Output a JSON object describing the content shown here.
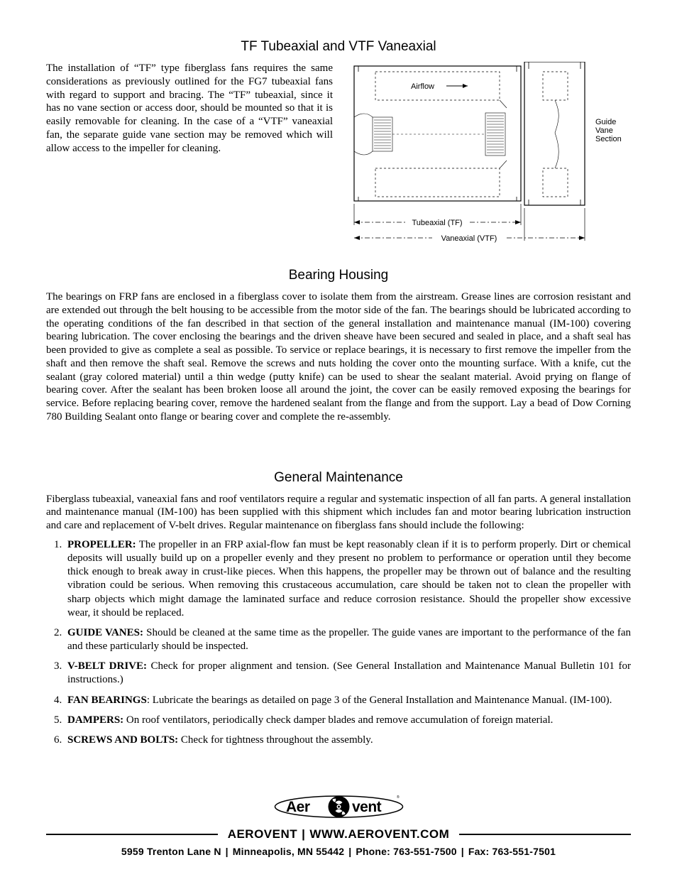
{
  "headings": {
    "h1": "TF Tubeaxial and VTF Vaneaxial",
    "h2": "Bearing Housing",
    "h3": "General Maintenance"
  },
  "top_paragraph": "The installation of “TF” type fiberglass fans requires the same considerations as previously outlined for the FG7 tubeaxial fans with regard to support and bracing. The “TF” tubeaxial, since it has no vane section or access door, should be mounted so that it is easily removable for cleaning. In the case of a “VTF” vaneaxial fan, the separate guide vane section may be removed which will allow access to the impeller for cleaning.",
  "figure": {
    "airflow": "Airflow",
    "guide_vane": "Guide\nVane\nSection",
    "tubeaxial": "Tubeaxial (TF)",
    "vaneaxial": "Vaneaxial (VTF)"
  },
  "bearing_paragraph": "The bearings on FRP fans are enclosed in a fiberglass cover to isolate them from the airstream. Grease lines are corrosion resistant and are extended out through the belt housing to be accessible from the motor side of the fan. The bearings should be lubricated according to the operating conditions of the fan described in that section of the general installation and maintenance manual (IM-100) covering bearing lubrication. The cover enclosing the bearings and the driven sheave have been secured and sealed in place, and a shaft seal has been provided to give as complete a seal as possible. To service or replace bearings, it is necessary to first remove the impeller from the shaft and then remove the shaft seal. Remove the screws and nuts holding the cover onto the mounting surface. With a knife, cut the sealant (gray colored material) until a thin wedge (putty knife) can be used to shear the sealant material. Avoid prying on flange of bearing cover. After the sealant has been broken loose all around the joint, the cover can be easily removed exposing the bearings for service. Before replacing bearing cover, remove the hardened sealant from the flange and from the support. Lay a bead of Dow Corning 780 Building Sealant onto flange or bearing cover and complete the re-assembly.",
  "general_intro": "Fiberglass tubeaxial, vaneaxial fans and roof ventilators require a regular and systematic inspection of all fan parts. A general installation and maintenance manual (IM-100) has been supplied with this shipment which includes fan and motor bearing lubrication instruction and care and replacement of V-belt drives. Regular maintenance on fiberglass fans should include the following:",
  "maintenance": [
    {
      "label": "PROPELLER:",
      "text": " The propeller in an FRP axial-flow fan must be kept reasonably clean if it is to perform properly. Dirt or chemical deposits will usually build up on a propeller evenly and they present no problem to performance or operation until they become thick enough to break away in crust-like pieces. When this happens, the propeller may be thrown out of balance and the resulting vibration could be serious. When removing this crustaceous accumulation, care should be taken not to clean the propeller with sharp objects which might damage the laminated surface and reduce corrosion resistance. Should the propeller show excessive wear, it should be replaced."
    },
    {
      "label": "GUIDE VANES:",
      "text": " Should be cleaned at the same time as the propeller. The guide vanes are important to the performance of the fan and these particularly should be inspected."
    },
    {
      "label": "V-BELT DRIVE:",
      "text": " Check for proper alignment and tension. (See General Installation and Maintenance Manual Bulletin 101 for instructions.)"
    },
    {
      "label": "FAN BEARINGS",
      "text": ": Lubricate the bearings as detailed on page 3 of the General Installation and Maintenance Manual. (IM-100)."
    },
    {
      "label": "DAMPERS:",
      "text": " On roof ventilators, periodically check damper blades and remove accumulation of foreign material."
    },
    {
      "label": "SCREWS AND BOLTS:",
      "text": " Check for tightness throughout the assembly."
    }
  ],
  "footer": {
    "brand": "AEROVENT",
    "sep": "|",
    "url": "WWW.AEROVENT.COM",
    "address": "5959 Trenton Lane N",
    "city": "Minneapolis, MN 55442",
    "phone": "Phone: 763-551-7500",
    "fax": "Fax: 763-551-7501",
    "logo_text": "Aerovent"
  }
}
